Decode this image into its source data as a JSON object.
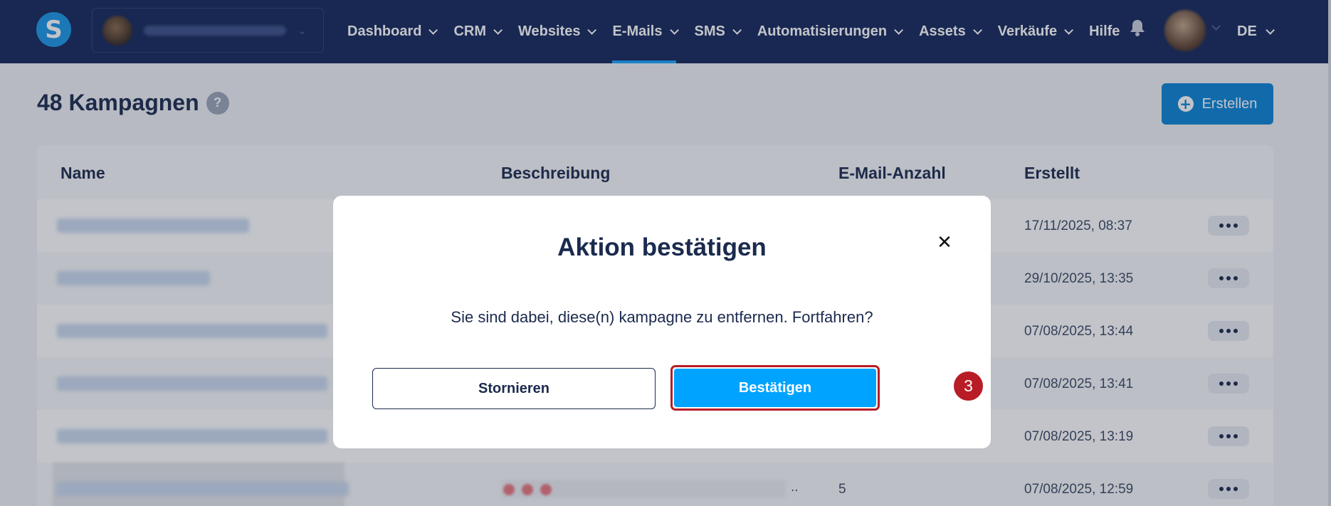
{
  "nav": {
    "logo": "S",
    "items": [
      {
        "label": "Dashboard",
        "dropdown": true
      },
      {
        "label": "CRM",
        "dropdown": true
      },
      {
        "label": "Websites",
        "dropdown": true
      },
      {
        "label": "E-Mails",
        "dropdown": true,
        "active": true
      },
      {
        "label": "SMS",
        "dropdown": true
      },
      {
        "label": "Automatisierungen",
        "dropdown": true
      },
      {
        "label": "Assets",
        "dropdown": true
      },
      {
        "label": "Verkäufe",
        "dropdown": true
      },
      {
        "label": "Hilfe",
        "dropdown": false
      }
    ],
    "language": "DE"
  },
  "page": {
    "title": "48 Kampagnen",
    "help": "?",
    "create_label": "Erstellen"
  },
  "table": {
    "columns": [
      "Name",
      "Beschreibung",
      "E-Mail-Anzahl",
      "Erstellt"
    ],
    "rows": [
      {
        "created": "17/11/2025, 08:37",
        "count": ""
      },
      {
        "created": "29/10/2025, 13:35",
        "count": ""
      },
      {
        "created": "07/08/2025, 13:44",
        "count": ""
      },
      {
        "created": "07/08/2025, 13:41",
        "count": ""
      },
      {
        "created": "07/08/2025, 13:19",
        "count": ""
      },
      {
        "created": "07/08/2025, 12:59",
        "count": "5",
        "desc_ellipsis": ".."
      }
    ]
  },
  "modal": {
    "title": "Aktion bestätigen",
    "message": "Sie sind dabei, diese(n) kampagne zu entfernen. Fortfahren?",
    "cancel_label": "Stornieren",
    "confirm_label": "Bestätigen",
    "close_icon": "close-icon",
    "step_number": "3"
  },
  "colors": {
    "nav_bg": "#14275a",
    "accent": "#00a3ff",
    "create_bg": "#0b84d6",
    "highlight": "#b81c27"
  }
}
